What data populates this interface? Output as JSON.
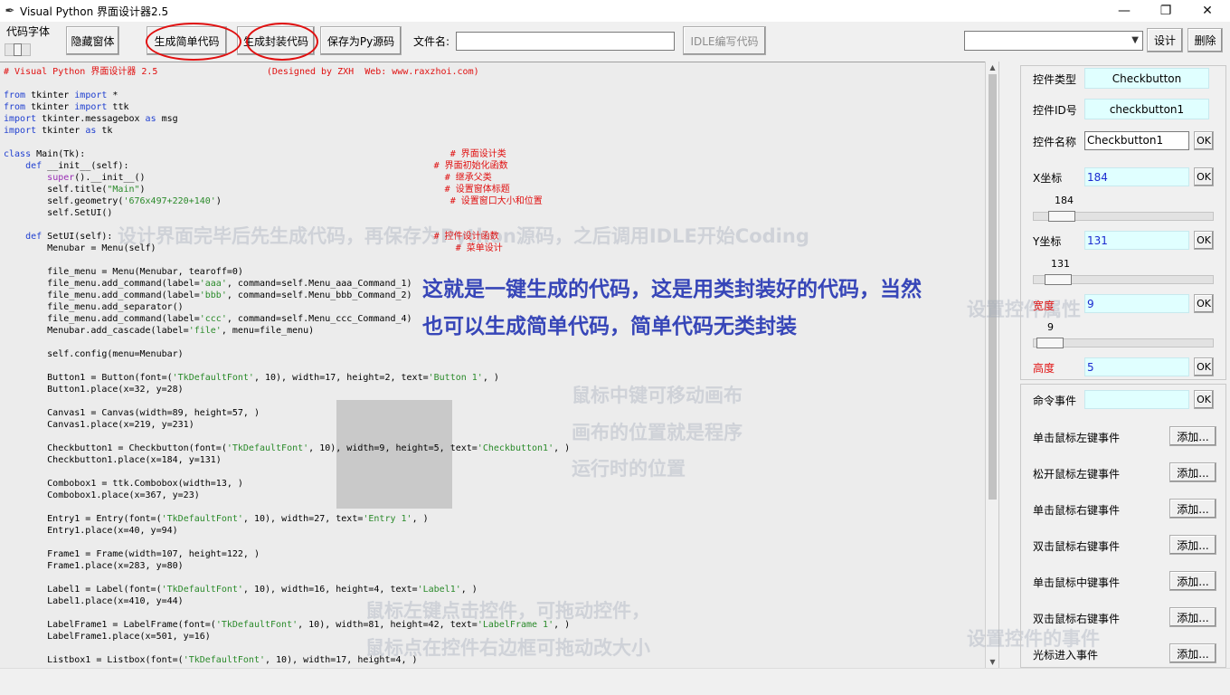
{
  "window": {
    "title": "Visual Python 界面设计器2.5",
    "minimize": "—",
    "maximize": "❐",
    "close": "✕"
  },
  "toolbar": {
    "font_label": "代码字体",
    "hide_window": "隐藏窗体",
    "gen_simple": "生成简单代码",
    "gen_class": "生成封装代码",
    "save_py": "保存为Py源码",
    "filename_label": "文件名:",
    "filename_value": "",
    "idle_button": "IDLE编写代码",
    "combo_value": "",
    "set_button": "设计",
    "delete_button": "删除"
  },
  "code": [
    [
      [
        "cm",
        "# Visual Python 界面设计器 2.5                    (Designed by ZXH  Web: www.raxzhoi.com)"
      ]
    ],
    [],
    [
      [
        "kw",
        "from"
      ],
      [
        "",
        " tkinter "
      ],
      [
        "kw",
        "import"
      ],
      [
        "",
        " *"
      ]
    ],
    [
      [
        "kw",
        "from"
      ],
      [
        "",
        " tkinter "
      ],
      [
        "kw",
        "import"
      ],
      [
        "",
        " ttk"
      ]
    ],
    [
      [
        "kw",
        "import"
      ],
      [
        "",
        " tkinter.messagebox "
      ],
      [
        "kw",
        "as"
      ],
      [
        "",
        " msg"
      ]
    ],
    [
      [
        "kw",
        "import"
      ],
      [
        "",
        " tkinter "
      ],
      [
        "kw",
        "as"
      ],
      [
        "",
        " tk"
      ]
    ],
    [],
    [
      [
        "kw",
        "class"
      ],
      [
        "",
        " Main(Tk):                                                                   "
      ],
      [
        "cm",
        "# 界面设计类"
      ]
    ],
    [
      [
        "",
        "    "
      ],
      [
        "kw",
        "def"
      ],
      [
        "",
        " __init__(self):                                                        "
      ],
      [
        "cm",
        "# 界面初始化函数"
      ]
    ],
    [
      [
        "",
        "        "
      ],
      [
        "bi",
        "super"
      ],
      [
        "",
        "().__init__()                                                       "
      ],
      [
        "cm",
        "# 继承父类"
      ]
    ],
    [
      [
        "",
        "        self.title("
      ],
      [
        "st",
        "\"Main\""
      ],
      [
        "",
        ")                                                       "
      ],
      [
        "cm",
        "# 设置窗体标题"
      ]
    ],
    [
      [
        "",
        "        self.geometry("
      ],
      [
        "st",
        "'676x497+220+140'"
      ],
      [
        "",
        ")                                          "
      ],
      [
        "cm",
        "# 设置窗口大小和位置"
      ]
    ],
    [
      [
        "",
        "        self.SetUI()"
      ]
    ],
    [],
    [
      [
        "",
        "    "
      ],
      [
        "kw",
        "def"
      ],
      [
        "",
        " SetUI(self):                                                           "
      ],
      [
        "cm",
        "# 控件设计函数"
      ]
    ],
    [
      [
        "",
        "        Menubar = Menu(self)                                                       "
      ],
      [
        "cm",
        "# 菜单设计"
      ]
    ],
    [],
    [
      [
        "",
        "        file_menu = Menu(Menubar, tearoff=0)"
      ]
    ],
    [
      [
        "",
        "        file_menu.add_command(label="
      ],
      [
        "st",
        "'aaa'"
      ],
      [
        "",
        ", command=self.Menu_aaa_Command_1)"
      ]
    ],
    [
      [
        "",
        "        file_menu.add_command(label="
      ],
      [
        "st",
        "'bbb'"
      ],
      [
        "",
        ", command=self.Menu_bbb_Command_2)"
      ]
    ],
    [
      [
        "",
        "        file_menu.add_separator()"
      ]
    ],
    [
      [
        "",
        "        file_menu.add_command(label="
      ],
      [
        "st",
        "'ccc'"
      ],
      [
        "",
        ", command=self.Menu_ccc_Command_4)"
      ]
    ],
    [
      [
        "",
        "        Menubar.add_cascade(label="
      ],
      [
        "st",
        "'file'"
      ],
      [
        "",
        ", menu=file_menu)"
      ]
    ],
    [],
    [
      [
        "",
        "        self.config(menu=Menubar)"
      ]
    ],
    [],
    [
      [
        "",
        "        Button1 = Button(font=("
      ],
      [
        "st",
        "'TkDefaultFont'"
      ],
      [
        "",
        ", 10), width=17, height=2, text="
      ],
      [
        "st",
        "'Button 1'"
      ],
      [
        "",
        ", )"
      ]
    ],
    [
      [
        "",
        "        Button1.place(x=32, y=28)"
      ]
    ],
    [],
    [
      [
        "",
        "        Canvas1 = Canvas(width=89, height=57, )"
      ]
    ],
    [
      [
        "",
        "        Canvas1.place(x=219, y=231)"
      ]
    ],
    [],
    [
      [
        "",
        "        Checkbutton1 = Checkbutton(font=("
      ],
      [
        "st",
        "'TkDefaultFont'"
      ],
      [
        "",
        ", 10), width=9, height=5, text="
      ],
      [
        "st",
        "'Checkbutton1'"
      ],
      [
        "",
        ", )"
      ]
    ],
    [
      [
        "",
        "        Checkbutton1.place(x=184, y=131)"
      ]
    ],
    [],
    [
      [
        "",
        "        Combobox1 = ttk.Combobox(width=13, )"
      ]
    ],
    [
      [
        "",
        "        Combobox1.place(x=367, y=23)"
      ]
    ],
    [],
    [
      [
        "",
        "        Entry1 = Entry(font=("
      ],
      [
        "st",
        "'TkDefaultFont'"
      ],
      [
        "",
        ", 10), width=27, text="
      ],
      [
        "st",
        "'Entry 1'"
      ],
      [
        "",
        ", )"
      ]
    ],
    [
      [
        "",
        "        Entry1.place(x=40, y=94)"
      ]
    ],
    [],
    [
      [
        "",
        "        Frame1 = Frame(width=107, height=122, )"
      ]
    ],
    [
      [
        "",
        "        Frame1.place(x=283, y=80)"
      ]
    ],
    [],
    [
      [
        "",
        "        Label1 = Label(font=("
      ],
      [
        "st",
        "'TkDefaultFont'"
      ],
      [
        "",
        ", 10), width=16, height=4, text="
      ],
      [
        "st",
        "'Label1'"
      ],
      [
        "",
        ", )"
      ]
    ],
    [
      [
        "",
        "        Label1.place(x=410, y=44)"
      ]
    ],
    [],
    [
      [
        "",
        "        LabelFrame1 = LabelFrame(font=("
      ],
      [
        "st",
        "'TkDefaultFont'"
      ],
      [
        "",
        ", 10), width=81, height=42, text="
      ],
      [
        "st",
        "'LabelFrame 1'"
      ],
      [
        "",
        ", )"
      ]
    ],
    [
      [
        "",
        "        LabelFrame1.place(x=501, y=16)"
      ]
    ],
    [],
    [
      [
        "",
        "        Listbox1 = Listbox(font=("
      ],
      [
        "st",
        "'TkDefaultFont'"
      ],
      [
        "",
        ", 10), width=17, height=4, )"
      ]
    ]
  ],
  "annotation": "这就是一键生成的代码，这是用类封装好的代码，当然也可以生成简单代码，简单代码无类封装",
  "ghost": {
    "hint1": "设计界面完毕后先生成代码，再保存为Python源码，之后调用IDLE开始Coding",
    "hint2": "鼠标中键可移动画布",
    "hint3": "画布的位置就是程序",
    "hint4": "运行时的位置",
    "hint5": "鼠标左键点击控件，可拖动控件，",
    "hint6": "鼠标点在控件右边框可拖动改大小",
    "hint7": "设置控件属性",
    "hint8": "设置控件的事件"
  },
  "props": {
    "type_label": "控件类型",
    "type_value": "Checkbutton",
    "id_label": "控件ID号",
    "id_value": "checkbutton1",
    "name_label": "控件名称",
    "name_value": "Checkbutton1",
    "x_label": "X坐标",
    "x_value": "184",
    "x_scale": "184",
    "y_label": "Y坐标",
    "y_value": "131",
    "y_scale": "131",
    "w_label": "宽度",
    "w_value": "9",
    "w_scale": "9",
    "h_label": "高度",
    "h_value": "5",
    "ok": "OK",
    "cmd_label": "命令事件",
    "cmd_value": "",
    "add": "添加...",
    "events": [
      "单击鼠标左键事件",
      "松开鼠标左键事件",
      "单击鼠标右键事件",
      "双击鼠标右键事件",
      "单击鼠标中键事件",
      "双击鼠标右键事件",
      "光标进入事件"
    ]
  }
}
